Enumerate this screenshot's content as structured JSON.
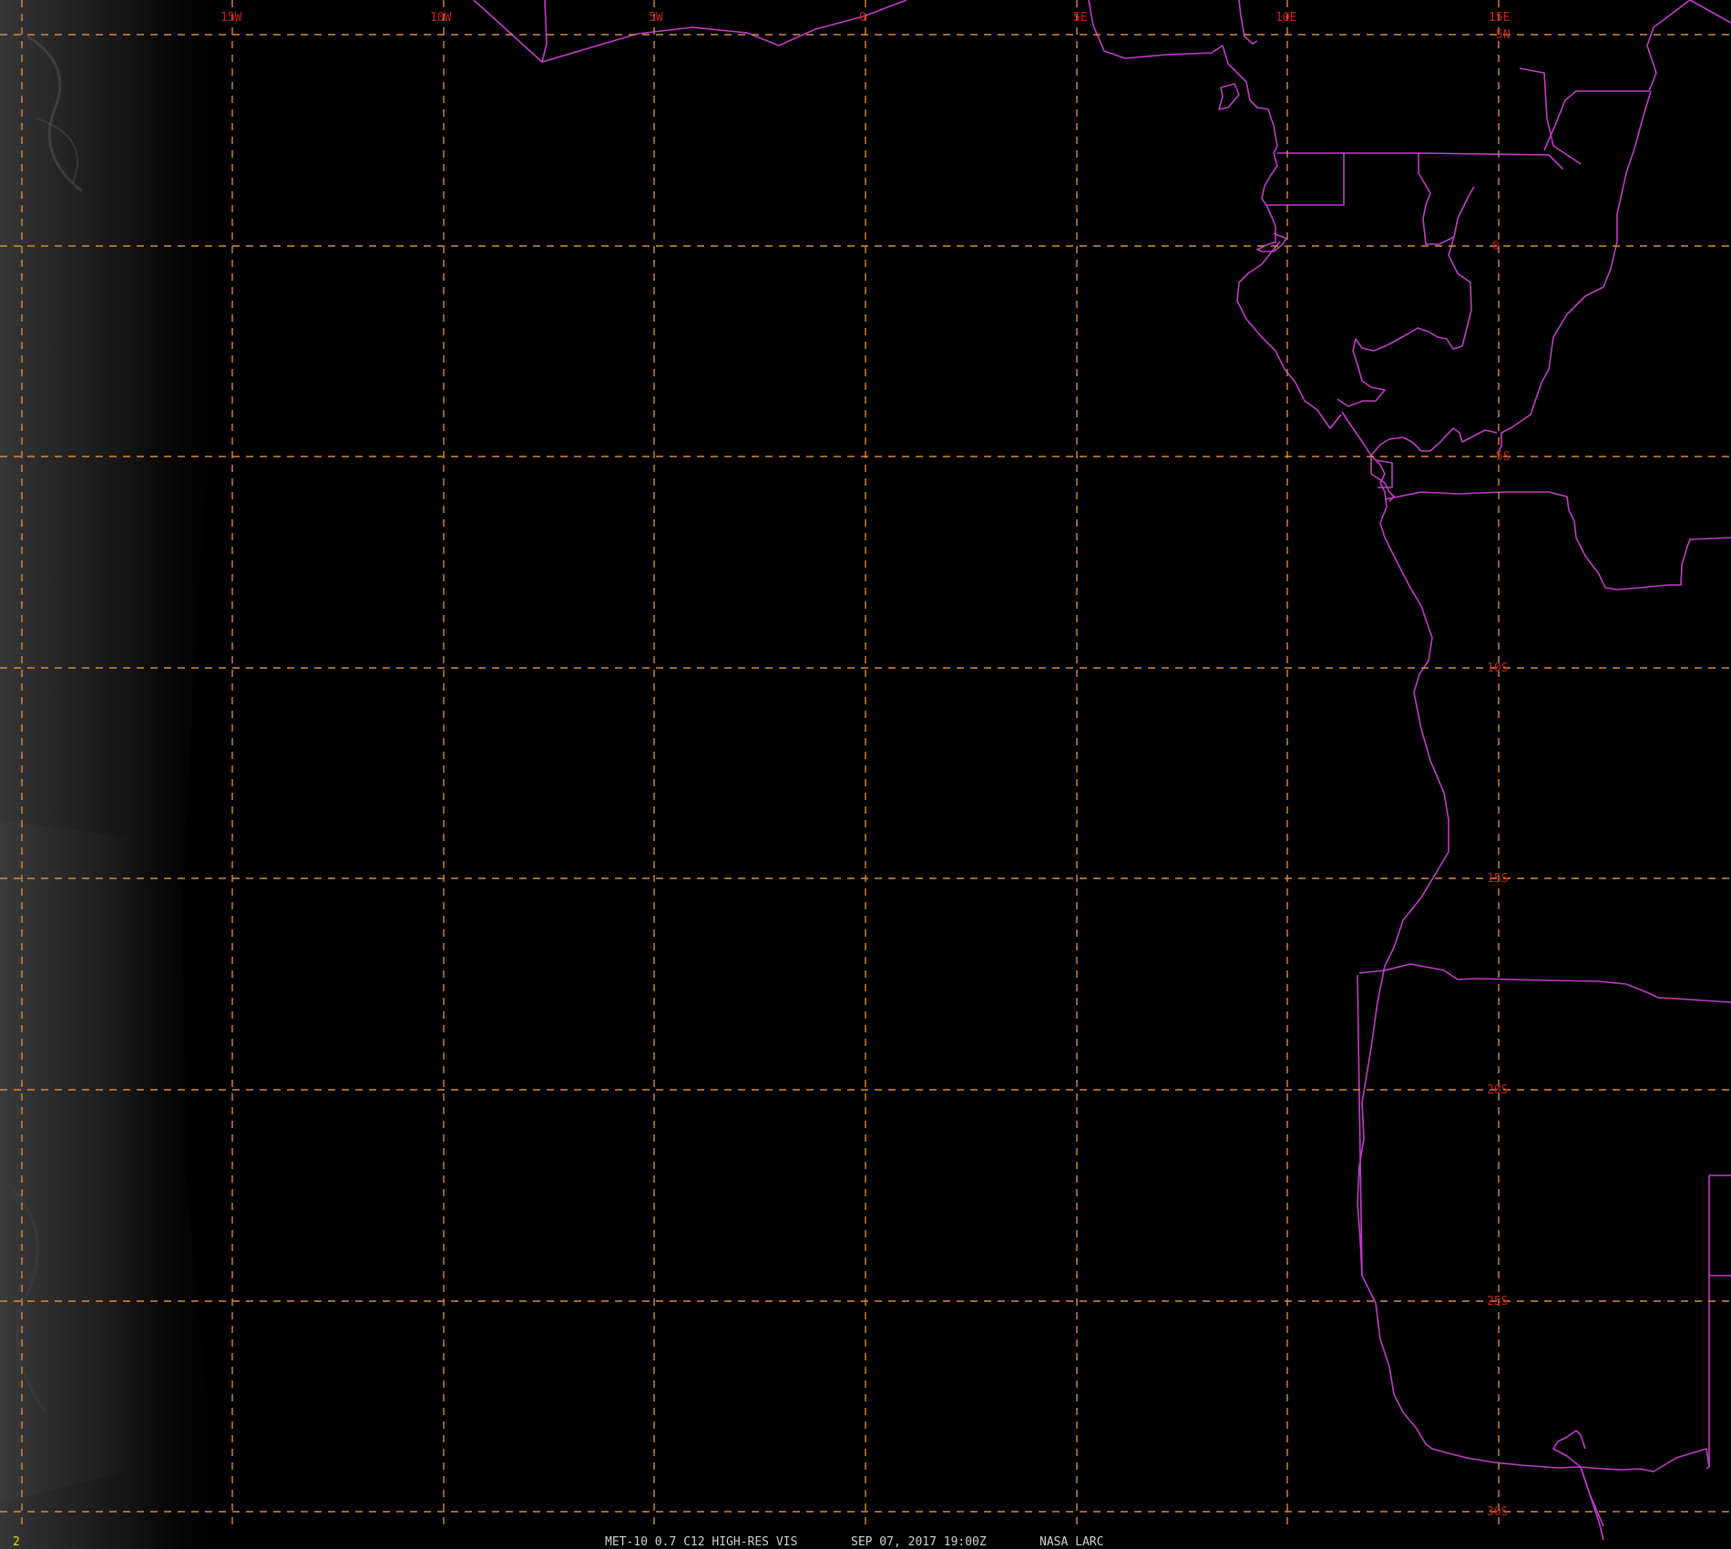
{
  "map": {
    "satellite_caption": "MET-10 0.7 C12 HIGH-RES VIS",
    "timestamp": "SEP 07, 2017 19:00Z",
    "credit": "NASA LARC",
    "frame_number": "2",
    "colors": {
      "background": "#000000",
      "grid": "#d98a3a",
      "grid_labels": "#c81e1e",
      "boundaries": "#c23cc8",
      "caption": "#d0d0d0",
      "frame_number": "#e0e000"
    },
    "grid_style": "dashed",
    "longitude_labels": [
      "15W",
      "10W",
      "5W",
      "0",
      "5E",
      "10E",
      "15E"
    ],
    "latitude_labels": [
      "5N",
      "0",
      "5S",
      "10S",
      "15S",
      "20S",
      "25S",
      "30S"
    ]
  }
}
